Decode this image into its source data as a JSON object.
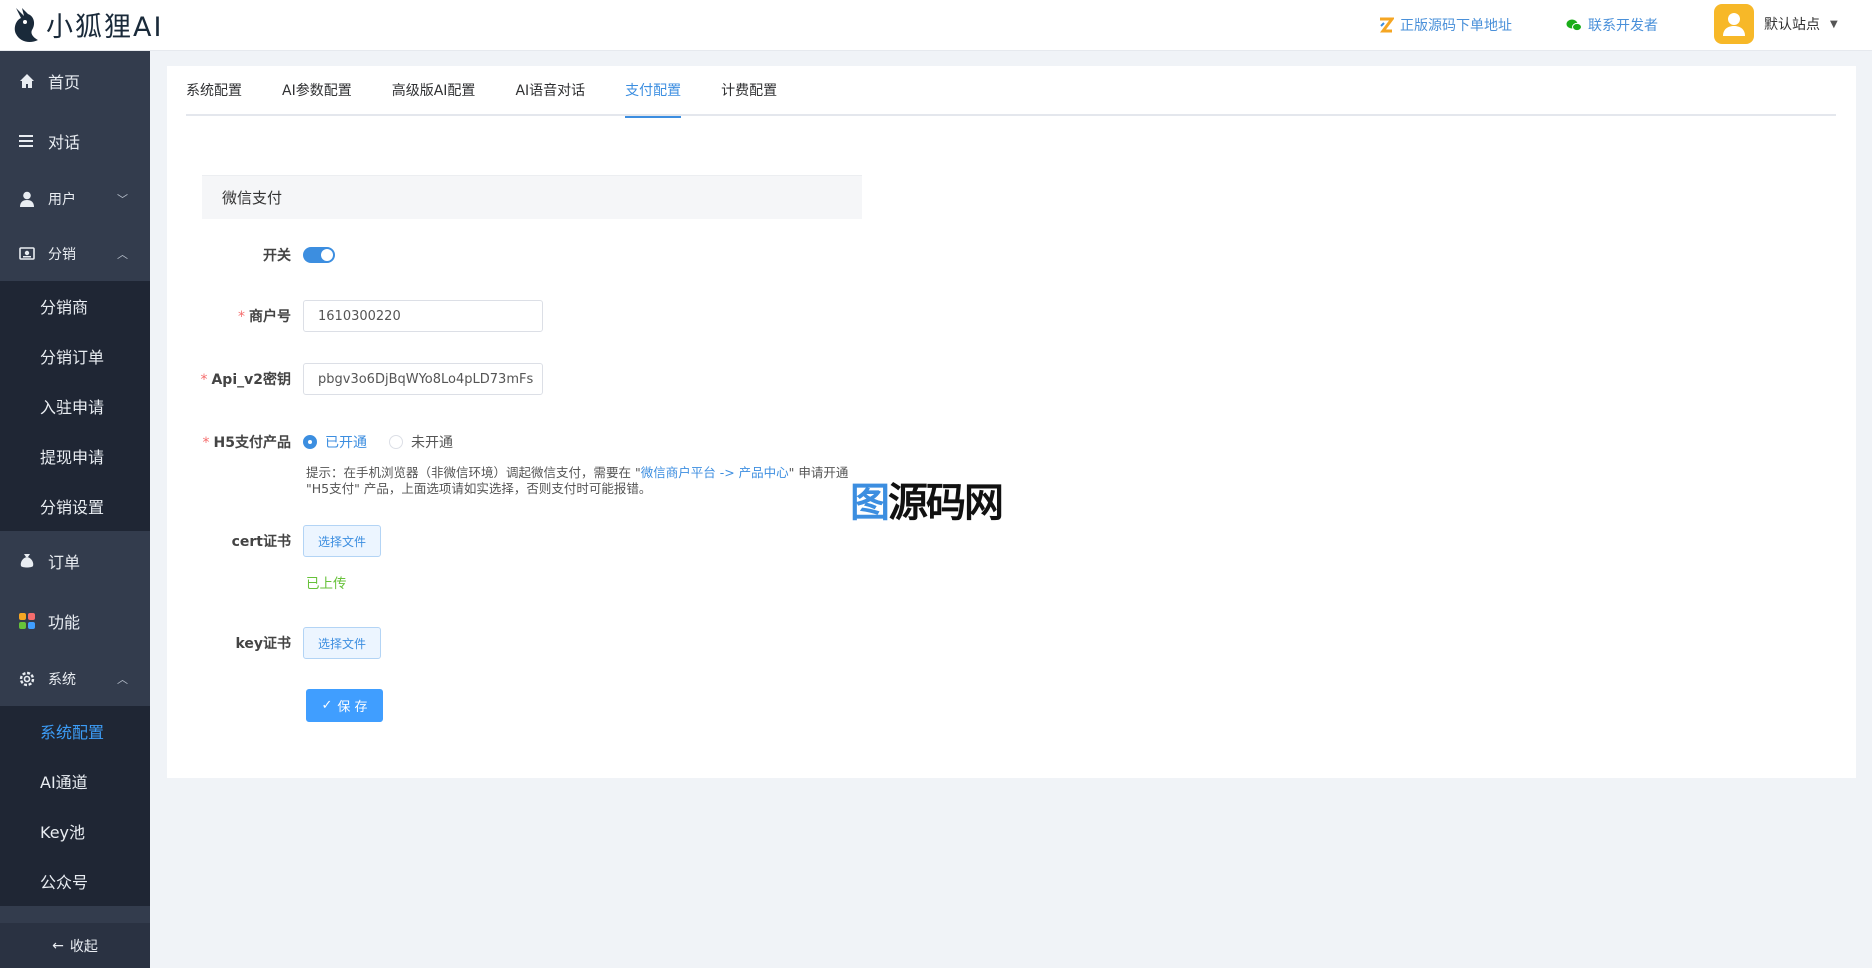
{
  "app": {
    "name": "小狐狸AI"
  },
  "header": {
    "links": [
      {
        "label": "正版源码下单地址",
        "icon": "brand-z-icon"
      },
      {
        "label": "联系开发者",
        "icon": "wechat-icon"
      }
    ],
    "user": {
      "name": "默认站点",
      "avatar_icon": "user-avatar-icon"
    }
  },
  "sidebar": {
    "items": [
      {
        "label": "首页",
        "icon": "home-icon"
      },
      {
        "label": "对话",
        "icon": "list-icon"
      },
      {
        "label": "用户",
        "icon": "user-icon",
        "expanded": false
      },
      {
        "label": "分销",
        "icon": "distribution-icon",
        "expanded": true,
        "children": [
          "分销商",
          "分销订单",
          "入驻申请",
          "提现申请",
          "分销设置"
        ]
      },
      {
        "label": "订单",
        "icon": "money-bag-icon"
      },
      {
        "label": "功能",
        "icon": "apps-icon"
      },
      {
        "label": "系统",
        "icon": "gear-icon",
        "expanded": true,
        "children": [
          "系统配置",
          "AI通道",
          "Key池",
          "公众号"
        ],
        "active_child": "系统配置"
      }
    ],
    "collapse_label": "收起"
  },
  "tabs": [
    "系统配置",
    "AI参数配置",
    "高级版AI配置",
    "AI语音对话",
    "支付配置",
    "计费配置"
  ],
  "active_tab": "支付配置",
  "form": {
    "section_title": "微信支付",
    "switch_label": "开关",
    "switch_on": true,
    "merchant_label": "商户号",
    "merchant_value": "1610300220",
    "apikey_label": "Api_v2密钥",
    "apikey_value": "pbgv3o6DjBqWYo8Lo4pLD73mFs",
    "h5_label": "H5支付产品",
    "h5_options": [
      "已开通",
      "未开通"
    ],
    "h5_selected": "已开通",
    "hint_prefix": "提示：在手机浏览器（非微信环境）调起微信支付，需要在 \"",
    "hint_link": "微信商户平台 -> 产品中心",
    "hint_suffix": "\" 申请开通 \"H5支付\" 产品，上面选项请如实选择，否则支付时可能报错。",
    "cert_label": "cert证书",
    "key_label": "key证书",
    "choose_file": "选择文件",
    "uploaded_text": "已上传",
    "save_label": "保 存"
  },
  "watermark": {
    "left": "图",
    "mid": "码",
    "text": "源码网"
  },
  "colors": {
    "accent": "#3c8ee0",
    "sidebar": "#333c4d",
    "submenu": "#1f2634",
    "success": "#67c23a"
  }
}
